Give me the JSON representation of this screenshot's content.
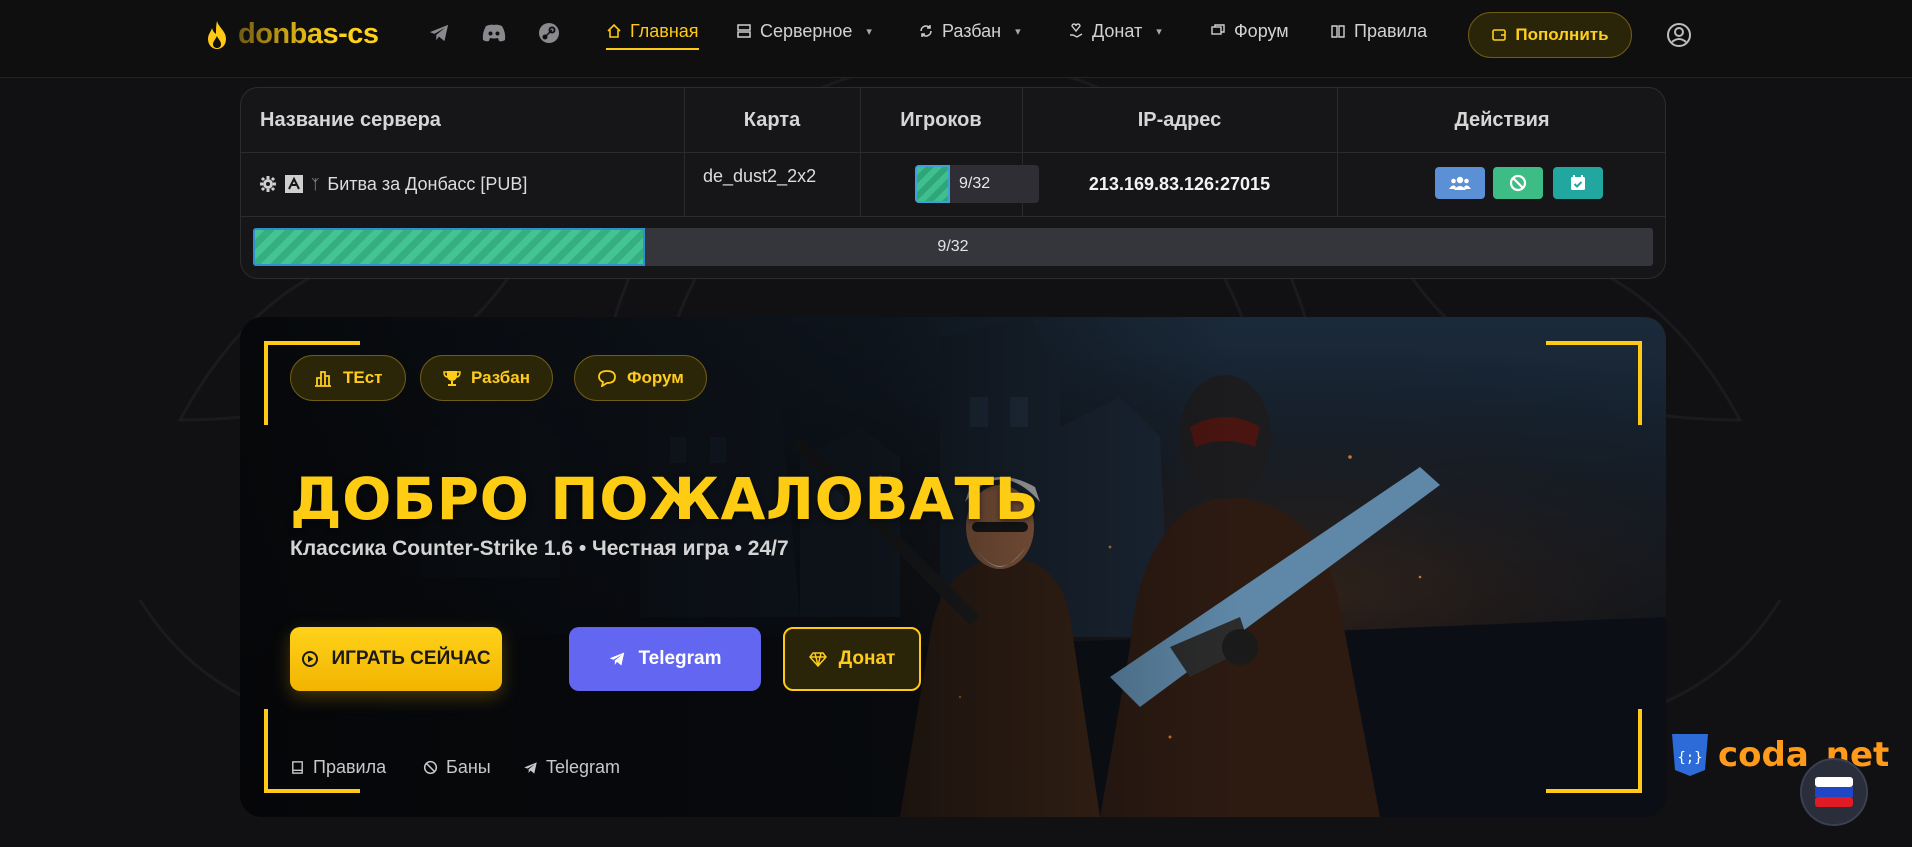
{
  "nav": {
    "logo_text": "donbas-cs",
    "menu": [
      {
        "label": "Главная",
        "icon": "home-icon",
        "active": true
      },
      {
        "label": "Серверное",
        "icon": "server-icon",
        "dropdown": true
      },
      {
        "label": "Разбан",
        "icon": "refresh-icon",
        "dropdown": true
      },
      {
        "label": "Донат",
        "icon": "donate-icon",
        "dropdown": true
      },
      {
        "label": "Форум",
        "icon": "chat-icon"
      },
      {
        "label": "Правила",
        "icon": "book-icon"
      }
    ],
    "topup_label": "Пополнить"
  },
  "servers": {
    "headers": [
      "Название сервера",
      "Карта",
      "Игроков",
      "IP-адрес",
      "Действия"
    ],
    "rows": [
      {
        "name": "Битва за Донбасс [PUB]",
        "map": "de_dust2_2x2",
        "players": "9/32",
        "players_fraction": 0.28,
        "ip": "213.169.83.126:27015"
      }
    ],
    "progress_label": "9/32",
    "progress_fraction": 0.28
  },
  "hero": {
    "chips": [
      {
        "label": "ТЕст",
        "icon": "chart-icon"
      },
      {
        "label": "Разбан",
        "icon": "trophy-icon"
      },
      {
        "label": "Форум",
        "icon": "chat-icon"
      }
    ],
    "title": "ДОБРО ПОЖАЛОВАТЬ",
    "subtitle": "Классика Counter-Strike 1.6 • Честная игра • 24/7",
    "play_label": "ИГРАТЬ СЕЙЧАС",
    "telegram_label": "Telegram",
    "donate_label": "Донат",
    "footer_links": [
      {
        "label": "Правила",
        "icon": "book-icon"
      },
      {
        "label": "Баны",
        "icon": "ban-icon"
      },
      {
        "label": "Telegram",
        "icon": "telegram-icon"
      }
    ]
  },
  "badge": {
    "text": "coda_net"
  },
  "colors": {
    "accent": "#ffc915",
    "telegram": "#6366f1",
    "green": "#3fbf8e",
    "blue_action": "#5b8fd6",
    "teal_action": "#22a6a0"
  }
}
